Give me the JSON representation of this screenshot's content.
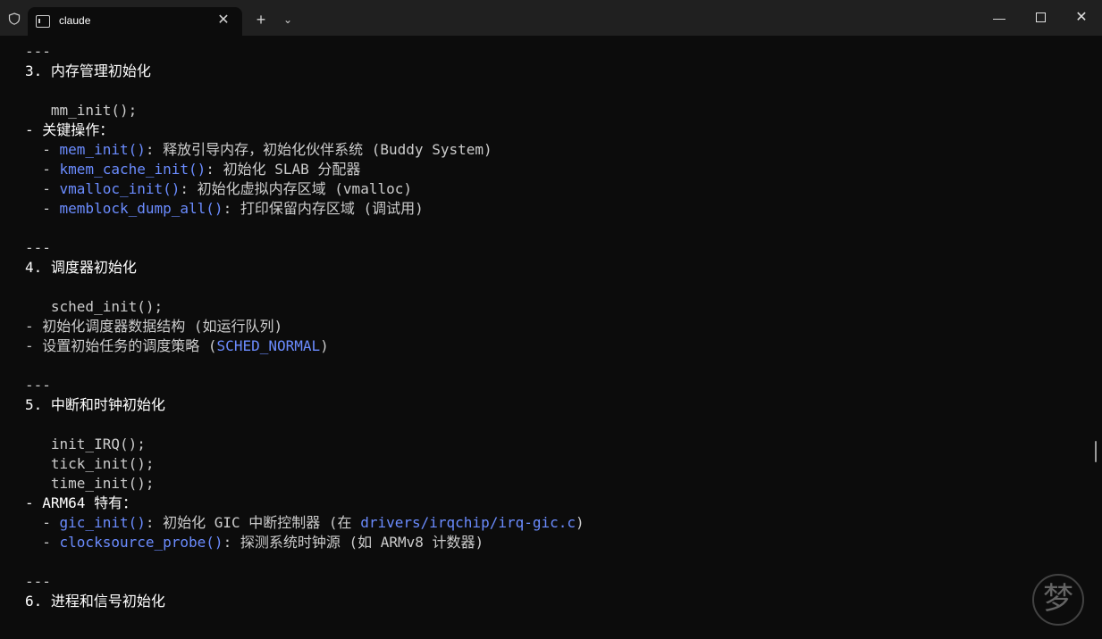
{
  "titlebar": {
    "tab_title": "claude",
    "tab_close": "✕",
    "new_tab": "+",
    "dropdown": "⌄",
    "minimize": "—",
    "close": "✕"
  },
  "terminal": {
    "lines": [
      {
        "segments": [
          {
            "t": "---"
          }
        ]
      },
      {
        "bright": true,
        "segments": [
          {
            "t": "3. 内存管理初始化"
          }
        ]
      },
      {
        "segments": [
          {
            "t": ""
          }
        ]
      },
      {
        "segments": [
          {
            "t": "   mm_init();"
          }
        ]
      },
      {
        "bright": true,
        "segments": [
          {
            "t": "- 关键操作："
          }
        ]
      },
      {
        "segments": [
          {
            "t": "  - "
          },
          {
            "t": "mem_init()",
            "c": "fn"
          },
          {
            "t": ": 释放引导内存，初始化伙伴系统 (Buddy System)"
          }
        ]
      },
      {
        "segments": [
          {
            "t": "  - "
          },
          {
            "t": "kmem_cache_init()",
            "c": "fn"
          },
          {
            "t": ": 初始化 SLAB 分配器"
          }
        ]
      },
      {
        "segments": [
          {
            "t": "  - "
          },
          {
            "t": "vmalloc_init()",
            "c": "fn"
          },
          {
            "t": ": 初始化虚拟内存区域 (vmalloc)"
          }
        ]
      },
      {
        "segments": [
          {
            "t": "  - "
          },
          {
            "t": "memblock_dump_all()",
            "c": "fn"
          },
          {
            "t": ": 打印保留内存区域 (调试用)"
          }
        ]
      },
      {
        "segments": [
          {
            "t": ""
          }
        ]
      },
      {
        "segments": [
          {
            "t": "---"
          }
        ]
      },
      {
        "bright": true,
        "segments": [
          {
            "t": "4. 调度器初始化"
          }
        ]
      },
      {
        "segments": [
          {
            "t": ""
          }
        ]
      },
      {
        "segments": [
          {
            "t": "   sched_init();"
          }
        ]
      },
      {
        "segments": [
          {
            "t": "- 初始化调度器数据结构 (如运行队列)"
          }
        ]
      },
      {
        "segments": [
          {
            "t": "- 设置初始任务的调度策略 ("
          },
          {
            "t": "SCHED_NORMAL",
            "c": "fn"
          },
          {
            "t": ")"
          }
        ]
      },
      {
        "segments": [
          {
            "t": ""
          }
        ]
      },
      {
        "segments": [
          {
            "t": "---"
          }
        ]
      },
      {
        "bright": true,
        "segments": [
          {
            "t": "5. 中断和时钟初始化"
          }
        ]
      },
      {
        "segments": [
          {
            "t": ""
          }
        ]
      },
      {
        "segments": [
          {
            "t": "   init_IRQ();"
          }
        ]
      },
      {
        "segments": [
          {
            "t": "   tick_init();"
          }
        ]
      },
      {
        "segments": [
          {
            "t": "   time_init();"
          }
        ]
      },
      {
        "bright": true,
        "segments": [
          {
            "t": "- ARM64 特有："
          }
        ]
      },
      {
        "segments": [
          {
            "t": "  - "
          },
          {
            "t": "gic_init()",
            "c": "fn"
          },
          {
            "t": ": 初始化 GIC 中断控制器 (在 "
          },
          {
            "t": "drivers/irqchip/irq-gic.c",
            "c": "fn"
          },
          {
            "t": ")"
          }
        ]
      },
      {
        "segments": [
          {
            "t": "  - "
          },
          {
            "t": "clocksource_probe()",
            "c": "fn"
          },
          {
            "t": ": 探测系统时钟源 (如 ARMv8 计数器)"
          }
        ]
      },
      {
        "segments": [
          {
            "t": ""
          }
        ]
      },
      {
        "segments": [
          {
            "t": "---"
          }
        ]
      },
      {
        "bright": true,
        "segments": [
          {
            "t": "6. 进程和信号初始化"
          }
        ]
      }
    ]
  },
  "watermark": {
    "text": "梦"
  }
}
